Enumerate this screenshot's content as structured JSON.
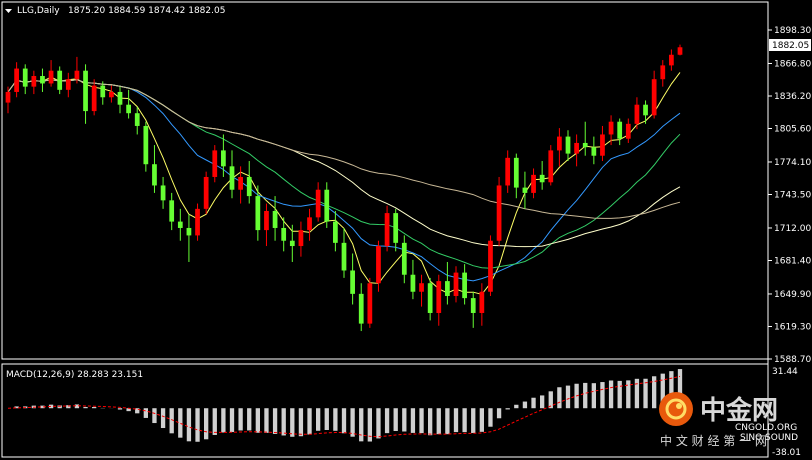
{
  "header": {
    "symbol": "LLG,Daily",
    "ohlc": "1875.20 1884.59 1874.42 1882.05"
  },
  "price_axis": {
    "ticks": [
      "1898.30",
      "1866.80",
      "1836.20",
      "1805.60",
      "1774.10",
      "1743.50",
      "1712.00",
      "1681.40",
      "1649.90",
      "1619.30",
      "1588.70"
    ],
    "current_price": "1882.05"
  },
  "macd": {
    "label": "MACD(12,26,9) 28.283 23.151",
    "axis_top": "31.44",
    "axis_bottom": "-38.01"
  },
  "watermark": {
    "brand": "中金网",
    "site": "CNGOLD.ORG",
    "tagline": "中 文 财 经 第 一 网",
    "sponsor": "SINO SOUND"
  },
  "colors": {
    "background": "#000000",
    "grid_border": "#ffffff",
    "bull": "#ff0000",
    "bear": "#66ff33",
    "ma_fast": "#ffff66",
    "ma_blue": "#3399ff",
    "ma_green": "#33cc66",
    "ma_pale": "#ffffcc",
    "ma_tan": "#c8b896",
    "macd_hist": "#d0d0d0",
    "macd_signal": "#ff0000"
  },
  "chart_data": {
    "type": "candlestick",
    "title": "LLG,Daily",
    "ylim": [
      1588.7,
      1898.3
    ],
    "candles": [
      {
        "o": 1830,
        "h": 1845,
        "l": 1820,
        "c": 1840
      },
      {
        "o": 1840,
        "h": 1868,
        "l": 1835,
        "c": 1862
      },
      {
        "o": 1862,
        "h": 1866,
        "l": 1838,
        "c": 1845
      },
      {
        "o": 1845,
        "h": 1860,
        "l": 1838,
        "c": 1855
      },
      {
        "o": 1855,
        "h": 1862,
        "l": 1840,
        "c": 1848
      },
      {
        "o": 1848,
        "h": 1870,
        "l": 1845,
        "c": 1860
      },
      {
        "o": 1860,
        "h": 1864,
        "l": 1838,
        "c": 1842
      },
      {
        "o": 1842,
        "h": 1858,
        "l": 1835,
        "c": 1852
      },
      {
        "o": 1852,
        "h": 1873,
        "l": 1848,
        "c": 1860
      },
      {
        "o": 1860,
        "h": 1866,
        "l": 1810,
        "c": 1822
      },
      {
        "o": 1822,
        "h": 1852,
        "l": 1818,
        "c": 1846
      },
      {
        "o": 1846,
        "h": 1850,
        "l": 1828,
        "c": 1835
      },
      {
        "o": 1835,
        "h": 1846,
        "l": 1830,
        "c": 1840
      },
      {
        "o": 1840,
        "h": 1845,
        "l": 1820,
        "c": 1828
      },
      {
        "o": 1828,
        "h": 1842,
        "l": 1815,
        "c": 1820
      },
      {
        "o": 1820,
        "h": 1826,
        "l": 1800,
        "c": 1808
      },
      {
        "o": 1808,
        "h": 1812,
        "l": 1765,
        "c": 1772
      },
      {
        "o": 1772,
        "h": 1790,
        "l": 1745,
        "c": 1752
      },
      {
        "o": 1752,
        "h": 1760,
        "l": 1730,
        "c": 1738
      },
      {
        "o": 1738,
        "h": 1745,
        "l": 1710,
        "c": 1718
      },
      {
        "o": 1718,
        "h": 1730,
        "l": 1700,
        "c": 1712
      },
      {
        "o": 1712,
        "h": 1725,
        "l": 1680,
        "c": 1705
      },
      {
        "o": 1705,
        "h": 1735,
        "l": 1700,
        "c": 1730
      },
      {
        "o": 1730,
        "h": 1765,
        "l": 1725,
        "c": 1760
      },
      {
        "o": 1760,
        "h": 1790,
        "l": 1755,
        "c": 1785
      },
      {
        "o": 1785,
        "h": 1800,
        "l": 1760,
        "c": 1770
      },
      {
        "o": 1770,
        "h": 1785,
        "l": 1740,
        "c": 1748
      },
      {
        "o": 1748,
        "h": 1770,
        "l": 1735,
        "c": 1760
      },
      {
        "o": 1760,
        "h": 1775,
        "l": 1735,
        "c": 1742
      },
      {
        "o": 1742,
        "h": 1752,
        "l": 1700,
        "c": 1710
      },
      {
        "o": 1710,
        "h": 1735,
        "l": 1695,
        "c": 1728
      },
      {
        "o": 1728,
        "h": 1742,
        "l": 1700,
        "c": 1712
      },
      {
        "o": 1712,
        "h": 1722,
        "l": 1690,
        "c": 1700
      },
      {
        "o": 1700,
        "h": 1715,
        "l": 1680,
        "c": 1695
      },
      {
        "o": 1695,
        "h": 1718,
        "l": 1685,
        "c": 1710
      },
      {
        "o": 1710,
        "h": 1730,
        "l": 1700,
        "c": 1722
      },
      {
        "o": 1722,
        "h": 1755,
        "l": 1718,
        "c": 1748
      },
      {
        "o": 1748,
        "h": 1755,
        "l": 1712,
        "c": 1718
      },
      {
        "o": 1718,
        "h": 1728,
        "l": 1690,
        "c": 1698
      },
      {
        "o": 1698,
        "h": 1712,
        "l": 1665,
        "c": 1672
      },
      {
        "o": 1672,
        "h": 1688,
        "l": 1640,
        "c": 1650
      },
      {
        "o": 1650,
        "h": 1660,
        "l": 1615,
        "c": 1622
      },
      {
        "o": 1622,
        "h": 1665,
        "l": 1618,
        "c": 1660
      },
      {
        "o": 1660,
        "h": 1700,
        "l": 1652,
        "c": 1695
      },
      {
        "o": 1695,
        "h": 1733,
        "l": 1690,
        "c": 1726
      },
      {
        "o": 1726,
        "h": 1730,
        "l": 1690,
        "c": 1698
      },
      {
        "o": 1698,
        "h": 1705,
        "l": 1660,
        "c": 1668
      },
      {
        "o": 1668,
        "h": 1682,
        "l": 1645,
        "c": 1652
      },
      {
        "o": 1652,
        "h": 1668,
        "l": 1638,
        "c": 1660
      },
      {
        "o": 1660,
        "h": 1665,
        "l": 1625,
        "c": 1632
      },
      {
        "o": 1632,
        "h": 1668,
        "l": 1620,
        "c": 1662
      },
      {
        "o": 1662,
        "h": 1680,
        "l": 1640,
        "c": 1648
      },
      {
        "o": 1648,
        "h": 1676,
        "l": 1642,
        "c": 1670
      },
      {
        "o": 1670,
        "h": 1678,
        "l": 1640,
        "c": 1646
      },
      {
        "o": 1646,
        "h": 1652,
        "l": 1618,
        "c": 1632
      },
      {
        "o": 1632,
        "h": 1660,
        "l": 1620,
        "c": 1652
      },
      {
        "o": 1652,
        "h": 1705,
        "l": 1648,
        "c": 1700
      },
      {
        "o": 1700,
        "h": 1760,
        "l": 1695,
        "c": 1752
      },
      {
        "o": 1752,
        "h": 1785,
        "l": 1745,
        "c": 1778
      },
      {
        "o": 1778,
        "h": 1782,
        "l": 1740,
        "c": 1750
      },
      {
        "o": 1750,
        "h": 1765,
        "l": 1730,
        "c": 1745
      },
      {
        "o": 1745,
        "h": 1768,
        "l": 1740,
        "c": 1762
      },
      {
        "o": 1762,
        "h": 1775,
        "l": 1748,
        "c": 1755
      },
      {
        "o": 1755,
        "h": 1790,
        "l": 1752,
        "c": 1785
      },
      {
        "o": 1785,
        "h": 1806,
        "l": 1770,
        "c": 1798
      },
      {
        "o": 1798,
        "h": 1804,
        "l": 1775,
        "c": 1782
      },
      {
        "o": 1782,
        "h": 1800,
        "l": 1770,
        "c": 1792
      },
      {
        "o": 1792,
        "h": 1812,
        "l": 1780,
        "c": 1788
      },
      {
        "o": 1788,
        "h": 1798,
        "l": 1772,
        "c": 1780
      },
      {
        "o": 1780,
        "h": 1808,
        "l": 1775,
        "c": 1800
      },
      {
        "o": 1800,
        "h": 1818,
        "l": 1790,
        "c": 1812
      },
      {
        "o": 1812,
        "h": 1815,
        "l": 1790,
        "c": 1796
      },
      {
        "o": 1796,
        "h": 1815,
        "l": 1792,
        "c": 1810
      },
      {
        "o": 1810,
        "h": 1835,
        "l": 1805,
        "c": 1828
      },
      {
        "o": 1828,
        "h": 1832,
        "l": 1810,
        "c": 1818
      },
      {
        "o": 1818,
        "h": 1860,
        "l": 1815,
        "c": 1852
      },
      {
        "o": 1852,
        "h": 1870,
        "l": 1845,
        "c": 1865
      },
      {
        "o": 1865,
        "h": 1880,
        "l": 1860,
        "c": 1875
      },
      {
        "o": 1875,
        "h": 1884.59,
        "l": 1874.42,
        "c": 1882.05
      }
    ],
    "series": [
      {
        "name": "",
        "values": []
      }
    ],
    "macd": {
      "label": "MACD(12,26,9) 28.283 23.151",
      "macd_value": 28.283,
      "signal_value": 23.151,
      "ylim": [
        -38.01,
        31.44
      ]
    }
  }
}
